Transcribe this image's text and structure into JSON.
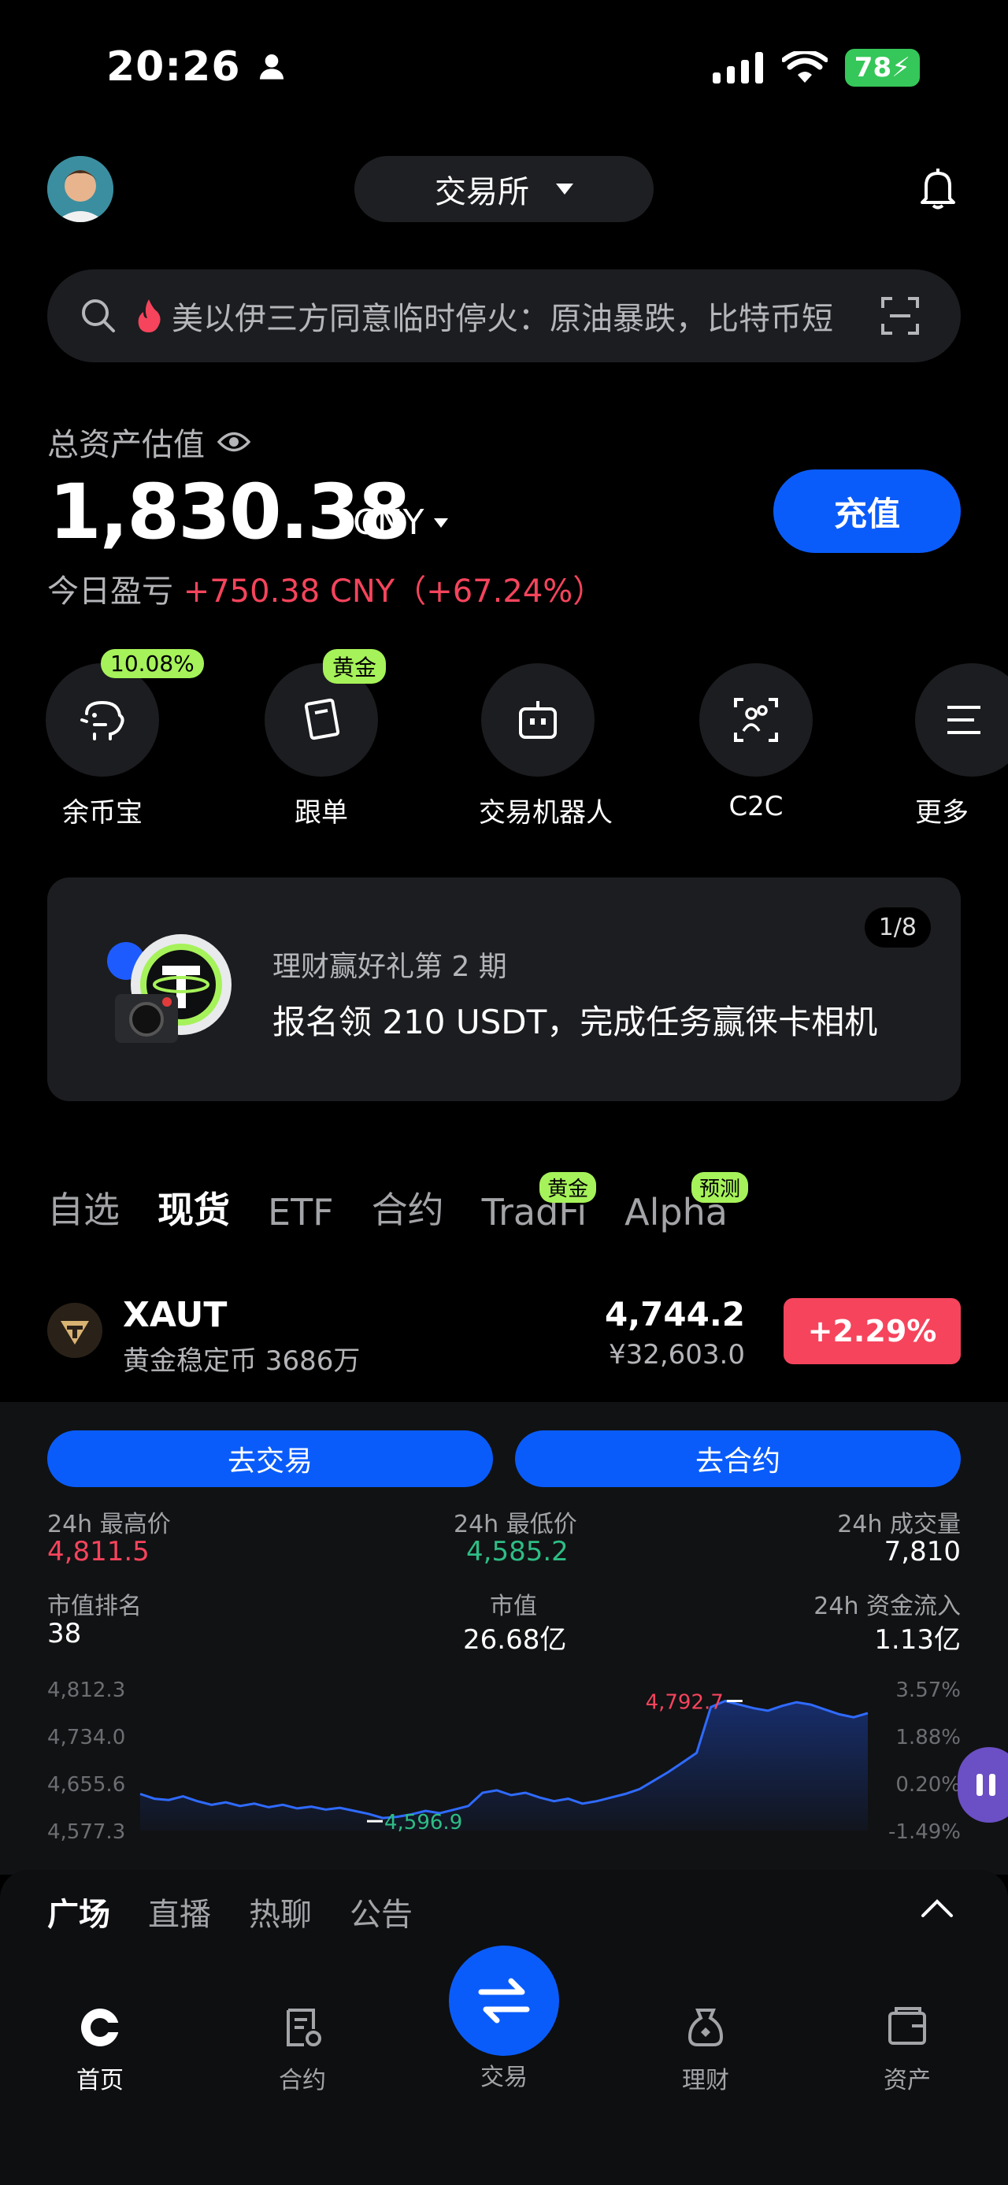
{
  "status_bar": {
    "time": "20:26",
    "battery": "78"
  },
  "header": {
    "exchange_label": "交易所"
  },
  "search": {
    "text": "美以伊三方同意临时停火：原油暴跌，比特币短"
  },
  "assets": {
    "label": "总资产估值",
    "balance": "1,830.38",
    "currency": "CNY",
    "pnl_label": "今日盈亏",
    "pnl_value": "+750.38 CNY（+67.24%）",
    "deposit_label": "充值"
  },
  "quick_actions": [
    {
      "label": "余币宝",
      "badge": "10.08%"
    },
    {
      "label": "跟单",
      "badge": "黄金"
    },
    {
      "label": "交易机器人",
      "badge": ""
    },
    {
      "label": "C2C",
      "badge": ""
    },
    {
      "label": "更多",
      "badge": ""
    }
  ],
  "banner": {
    "pager": "1/8",
    "subtitle": "理财赢好礼第 2 期",
    "title": "报名领 210 USDT，完成任务赢徕卡相机"
  },
  "market_tabs": [
    {
      "label": "自选",
      "badge": ""
    },
    {
      "label": "现货",
      "badge": ""
    },
    {
      "label": "ETF",
      "badge": ""
    },
    {
      "label": "合约",
      "badge": ""
    },
    {
      "label": "TradFi",
      "badge": "黄金"
    },
    {
      "label": "Alpha",
      "badge": "预测"
    }
  ],
  "ticker": {
    "symbol": "XAUT",
    "subtitle": "黄金稳定币 3686万",
    "price": "4,744.2",
    "price_cny": "¥32,603.0",
    "change": "+2.29%"
  },
  "detail": {
    "trade_label": "去交易",
    "futures_label": "去合约",
    "stats": [
      {
        "label": "24h 最高价",
        "value": "4,811.5"
      },
      {
        "label": "24h 最低价",
        "value": "4,585.2"
      },
      {
        "label": "24h 成交量",
        "value": "7,810"
      },
      {
        "label": "市值排名",
        "value": "38"
      },
      {
        "label": "市值",
        "value": "26.68亿"
      },
      {
        "label": "24h 资金流入",
        "value": "1.13亿"
      }
    ]
  },
  "chart_data": {
    "type": "area",
    "y_ticks_left": [
      "4,812.3",
      "4,734.0",
      "4,655.6",
      "4,577.3"
    ],
    "y_ticks_right": [
      "3.57%",
      "1.88%",
      "0.20%",
      "-1.49%"
    ],
    "ylim": [
      4577.3,
      4812.3
    ],
    "max_label": "4,792.7",
    "min_label": "4,596.9",
    "line_color": "#2f6bff",
    "values": [
      4638,
      4630,
      4628,
      4634,
      4626,
      4620,
      4624,
      4618,
      4622,
      4616,
      4620,
      4614,
      4617,
      4612,
      4615,
      4610,
      4605,
      4598,
      4600,
      4604,
      4610,
      4606,
      4612,
      4618,
      4640,
      4644,
      4636,
      4640,
      4632,
      4626,
      4630,
      4622,
      4626,
      4632,
      4638,
      4646,
      4660,
      4674,
      4690,
      4706,
      4782,
      4792,
      4786,
      4780,
      4776,
      4784,
      4790,
      4786,
      4778,
      4770,
      4765,
      4772
    ]
  },
  "feed_tabs": [
    "广场",
    "直播",
    "热聊",
    "公告"
  ],
  "bottom_nav": [
    {
      "label": "首页",
      "icon": "home-icon"
    },
    {
      "label": "合约",
      "icon": "futures-icon"
    },
    {
      "label": "交易",
      "icon": "swap-icon"
    },
    {
      "label": "理财",
      "icon": "earn-icon"
    },
    {
      "label": "资产",
      "icon": "wallet-icon"
    }
  ]
}
